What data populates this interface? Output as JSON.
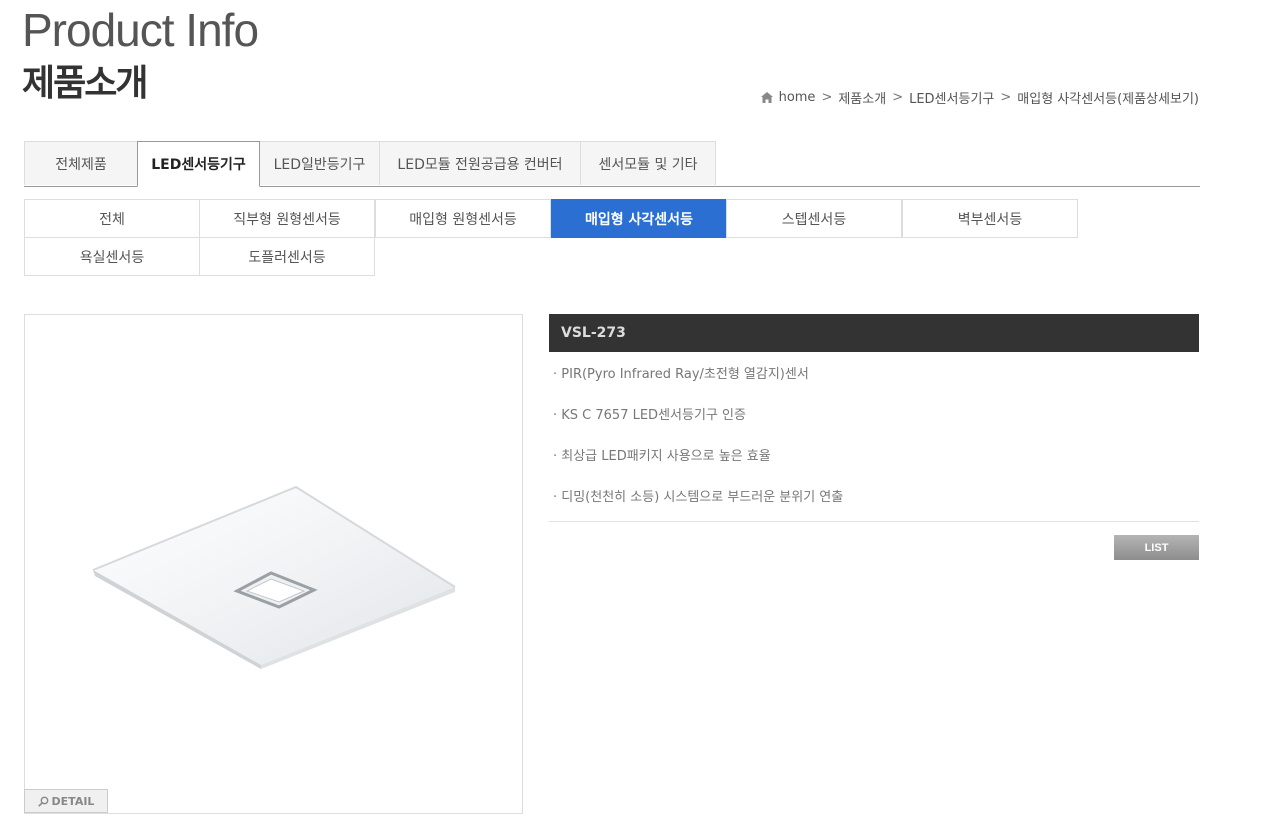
{
  "header": {
    "title_en": "Product Info",
    "title_ko": "제품소개"
  },
  "breadcrumb": {
    "items": [
      "home",
      "제품소개",
      "LED센서등기구",
      "매입형 사각센서등(제품상세보기)"
    ],
    "separator": ">"
  },
  "category_tabs": [
    {
      "label": "전체제품",
      "active": false
    },
    {
      "label": "LED센서등기구",
      "active": true
    },
    {
      "label": "LED일반등기구",
      "active": false
    },
    {
      "label": "LED모듈 전원공급용 컨버터",
      "active": false
    },
    {
      "label": "센서모듈 및 기타",
      "active": false
    }
  ],
  "sub_tabs": [
    {
      "label": "전체",
      "active": false
    },
    {
      "label": "직부형 원형센서등",
      "active": false
    },
    {
      "label": "매입형 원형센서등",
      "active": false
    },
    {
      "label": "매입형 사각센서등",
      "active": true
    },
    {
      "label": "스텝센서등",
      "active": false
    },
    {
      "label": "벽부센서등",
      "active": false
    },
    {
      "label": "욕실센서등",
      "active": false
    },
    {
      "label": "도플러센서등",
      "active": false
    }
  ],
  "product": {
    "model": "VSL-273",
    "features": [
      "· PIR(Pyro Infrared Ray/초전형 열감지)센서",
      "· KS C 7657 LED센서등기구 인증",
      "· 최상급 LED패키지 사용으로 높은 효율",
      "· 디밍(천천히 소등) 시스템으로 부드러운 분위기 연출"
    ],
    "detail_label": "DETAIL",
    "list_label": "LIST"
  },
  "colors": {
    "accent": "#2a6fd1",
    "model_bar": "#333333"
  },
  "icons": {
    "home": "home-icon",
    "detail": "magnifier-icon"
  }
}
